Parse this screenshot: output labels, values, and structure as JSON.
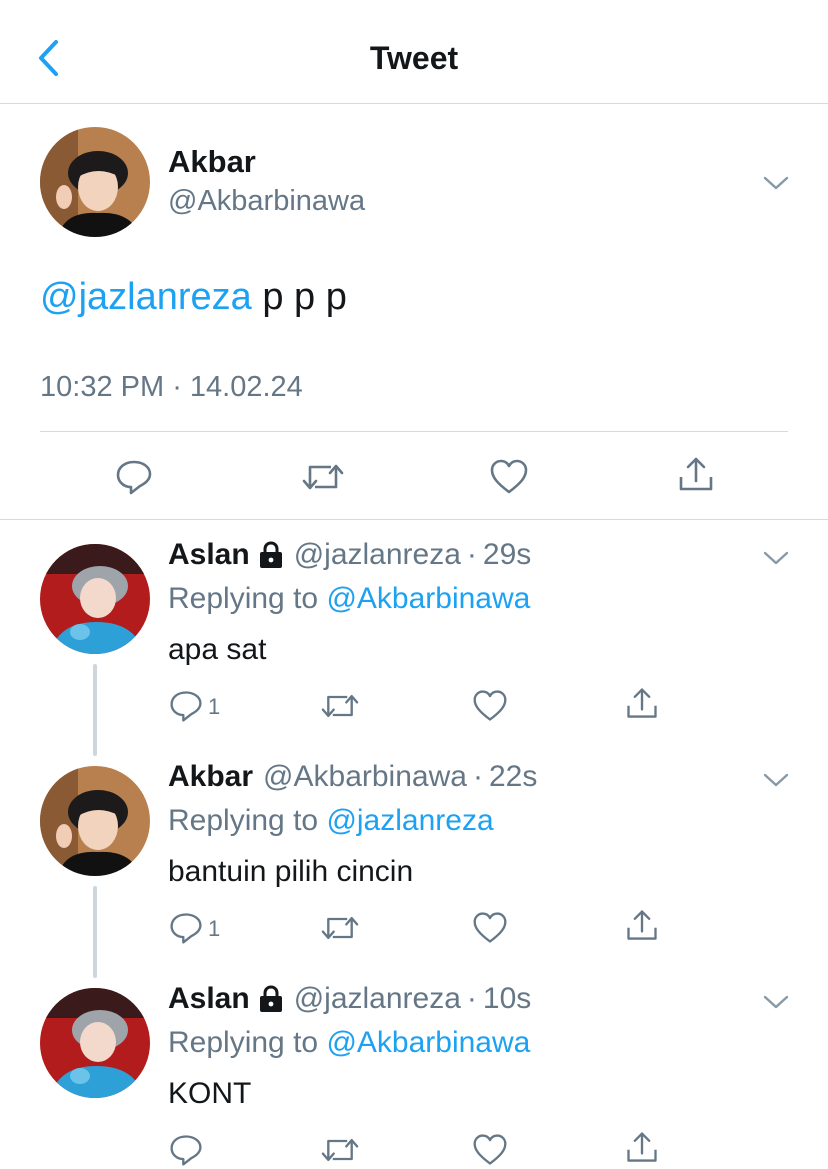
{
  "header": {
    "title": "Tweet",
    "back_icon": "chevron-left-icon",
    "accent": "#1da1f2"
  },
  "main_tweet": {
    "author_name": "Akbar",
    "author_handle": "@Akbarbinawa",
    "mention": "@jazlanreza",
    "text": " p p p",
    "time": "10:32 PM",
    "separator": " · ",
    "date": "14.02.24",
    "actions": [
      "reply-icon",
      "retweet-icon",
      "like-icon",
      "share-icon"
    ]
  },
  "replies": [
    {
      "author_name": "Aslan",
      "locked": true,
      "author_handle": "@jazlanreza",
      "dot": "·",
      "time": "29s",
      "replying_label": "Replying to ",
      "replying_to": "@Akbarbinawa",
      "text": "apa sat",
      "reply_count": "1"
    },
    {
      "author_name": "Akbar",
      "locked": false,
      "author_handle": "@Akbarbinawa",
      "dot": "·",
      "time": "22s",
      "replying_label": "Replying to ",
      "replying_to": "@jazlanreza",
      "text": "bantuin pilih cincin",
      "reply_count": "1"
    },
    {
      "author_name": "Aslan",
      "locked": true,
      "author_handle": "@jazlanreza",
      "dot": "·",
      "time": "10s",
      "replying_label": "Replying to ",
      "replying_to": "@Akbarbinawa",
      "text": "KONT",
      "reply_count": ""
    }
  ],
  "colors": {
    "text": "#14171a",
    "secondary": "#657786",
    "link": "#1da1f2",
    "divider": "#d9d9d9"
  }
}
